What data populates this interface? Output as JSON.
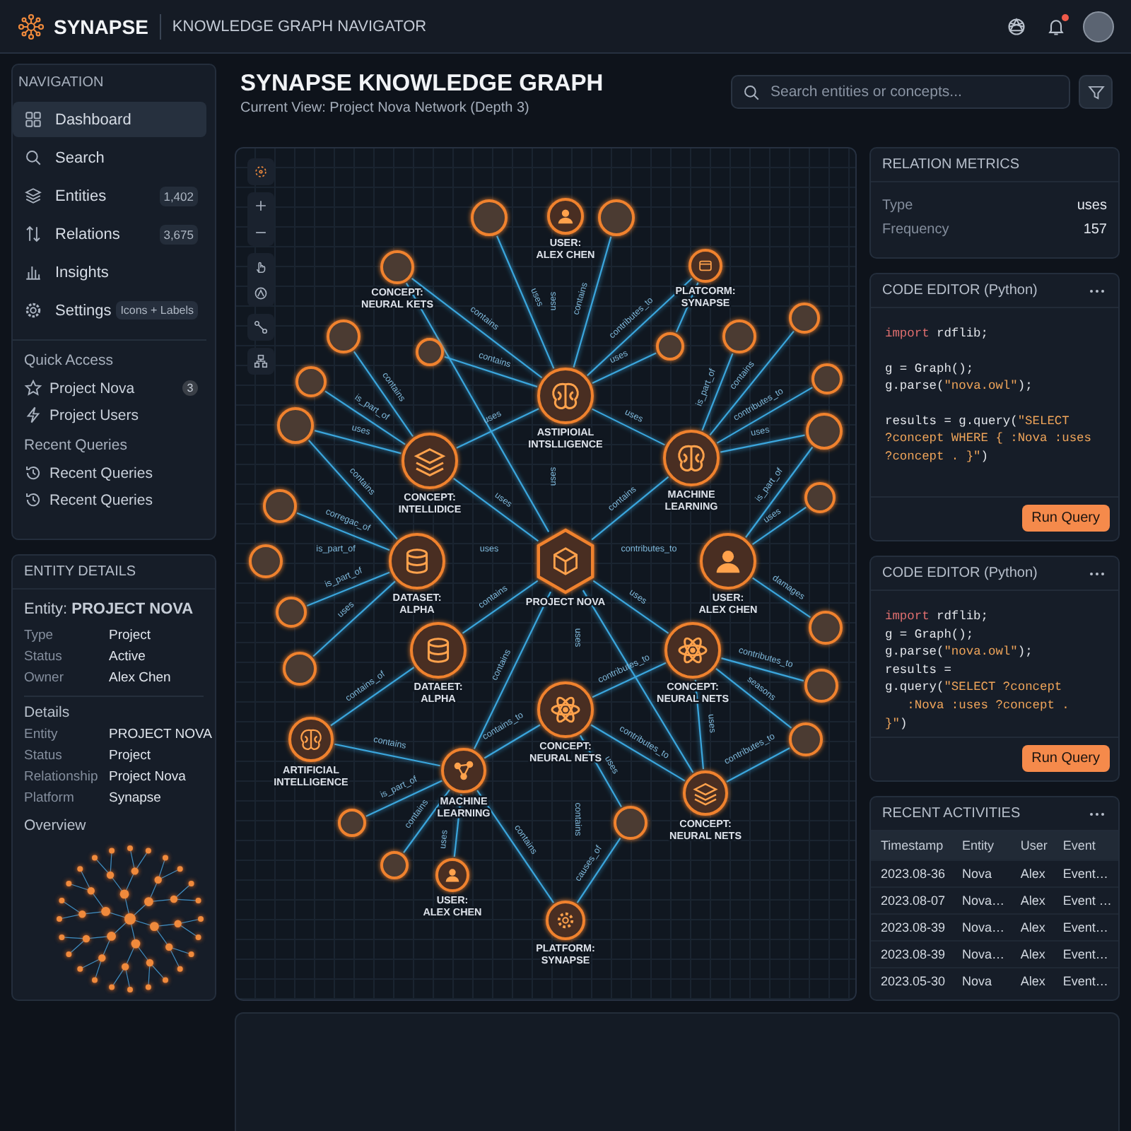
{
  "header": {
    "brand": "SYNAPSE",
    "subtitle": "KNOWLEDGE GRAPH NAVIGATOR",
    "unread_notifications": true
  },
  "sidebar": {
    "heading": "NAVIGATION",
    "items": [
      {
        "label": "Dashboard",
        "selected": true
      },
      {
        "label": "Search",
        "selected": false
      },
      {
        "label": "Entities",
        "count": "1,402",
        "selected": false
      },
      {
        "label": "Relations",
        "count": "3,675",
        "selected": false
      },
      {
        "label": "Insights",
        "selected": false
      },
      {
        "label": "Settings",
        "tag": "Icons + Labels",
        "selected": false
      }
    ],
    "quick_access": {
      "heading": "Quick Access",
      "items": [
        {
          "label": "Project Nova",
          "count": "3"
        },
        {
          "label": "Project Users"
        }
      ]
    },
    "recent_queries": {
      "heading": "Recent Queries",
      "items": [
        "Recent Queries",
        "Recent Queries"
      ]
    }
  },
  "entity_details": {
    "title": "ENTITY DETAILS",
    "entity": "Entity: **PROJECT NOVA**",
    "fields": [
      {
        "label": "Type",
        "value": "Project"
      },
      {
        "label": "Status",
        "value": "Active"
      },
      {
        "label": "Owner",
        "value": "Alex Chen"
      }
    ],
    "details_heading": "Details",
    "details": [
      {
        "label": "Entity",
        "value": "PROJECT NOVA"
      },
      {
        "label": "Status",
        "value": "Project"
      },
      {
        "label": "Relationship",
        "value": "Project Nova"
      },
      {
        "label": "Platform",
        "value": "Synapse"
      }
    ],
    "overview_heading": "Overview"
  },
  "main": {
    "title": "SYNAPSE KNOWLEDGE GRAPH",
    "current_view": "Current View: Project Nova Network (Depth 3)",
    "search": {
      "placeholder": "Search entities or concepts..."
    }
  },
  "graph": {
    "nodes": [
      {
        "kind": "entity",
        "label_lines": [
          "USER:",
          "ALEX CHEN"
        ]
      },
      {
        "kind": "leaf"
      },
      {
        "kind": "leaf"
      },
      {
        "kind": "leaf",
        "label_lines": [
          "CONCEPT:",
          "NEURAL KETS"
        ]
      },
      {
        "kind": "entity",
        "label_lines": [
          "PLATCORM:",
          "SYNAPSE"
        ]
      },
      {
        "kind": "leaf"
      },
      {
        "kind": "leaf"
      },
      {
        "kind": "leaf"
      },
      {
        "kind": "leaf"
      },
      {
        "kind": "leaf"
      },
      {
        "kind": "leaf"
      },
      {
        "kind": "leaf"
      },
      {
        "kind": "entity",
        "label_lines": [
          "ASTIPIOIAL",
          "INTSLLIGENCE"
        ]
      },
      {
        "kind": "leaf"
      },
      {
        "kind": "leaf"
      },
      {
        "kind": "entity",
        "label_lines": [
          "CONCEPT:",
          "INTELLIDICE"
        ]
      },
      {
        "kind": "entity",
        "label_lines": [
          "MACHINE",
          "LEARNING"
        ]
      },
      {
        "kind": "leaf"
      },
      {
        "kind": "leaf"
      },
      {
        "kind": "entity",
        "label_lines": [
          "DATASET:",
          "ALPHA"
        ]
      },
      {
        "kind": "hub",
        "label_lines": [
          "PROJECT NOVA"
        ]
      },
      {
        "kind": "entity",
        "label_lines": [
          "USER:",
          "ALEX CHEN"
        ]
      },
      {
        "kind": "leaf"
      },
      {
        "kind": "leaf"
      },
      {
        "kind": "leaf"
      },
      {
        "kind": "entity",
        "label_lines": [
          "DATAEET:",
          "ALPHA"
        ]
      },
      {
        "kind": "entity",
        "label_lines": [
          "CONCEPT:",
          "NEURAL NETS"
        ]
      },
      {
        "kind": "leaf"
      },
      {
        "kind": "leaf"
      },
      {
        "kind": "entity",
        "label_lines": [
          "CONCEPT:",
          "NEURAL NETS"
        ]
      },
      {
        "kind": "entity",
        "label_lines": [
          "ARTIFICIAL",
          "INTELLIGENCE"
        ]
      },
      {
        "kind": "leaf"
      },
      {
        "kind": "entity",
        "label_lines": [
          "MACHINE",
          "LEARNING"
        ]
      },
      {
        "kind": "entity",
        "label_lines": [
          "CONCEPT:",
          "NEURAL NETS"
        ]
      },
      {
        "kind": "leaf"
      },
      {
        "kind": "leaf"
      },
      {
        "kind": "leaf"
      },
      {
        "kind": "entity",
        "label_lines": [
          "USER:",
          "ALEX CHEN"
        ]
      },
      {
        "kind": "entity",
        "label_lines": [
          "PLATFORM:",
          "SYNAPSE"
        ]
      }
    ],
    "edges": [
      {
        "label": "uses"
      },
      {
        "label": "uses"
      },
      {
        "label": "contains"
      },
      {
        "label": "contains"
      },
      {
        "label": "contributes_to"
      },
      {
        "label": "contains"
      },
      {
        "label": "uses"
      },
      {
        "label": "contains"
      },
      {
        "label": "is_part_of"
      },
      {
        "label": "contains"
      },
      {
        "label": "is_part_of"
      },
      {
        "label": "contributes_to"
      },
      {
        "label": "uses"
      },
      {
        "label": "uses"
      },
      {
        "label": "uses"
      },
      {
        "label": "uses"
      },
      {
        "label": "uses"
      },
      {
        "label": "contains"
      },
      {
        "label": "is_part_of"
      },
      {
        "label": "uses"
      },
      {
        "label": "contains"
      },
      {
        "label": "uses"
      },
      {
        "label": "corregac_of"
      },
      {
        "label": "is_part_of"
      },
      {
        "label": "uses"
      },
      {
        "label": "contributes_to"
      },
      {
        "label": "is_part_of"
      },
      {
        "label": "damages"
      },
      {
        "label": "contains"
      },
      {
        "label": "uses"
      },
      {
        "label": "uses"
      },
      {
        "label": "uses"
      },
      {
        "label": "contains"
      },
      {
        "label": "contributes_to"
      },
      {
        "label": "contributes_to"
      },
      {
        "label": "contains_of"
      },
      {
        "label": "seasons"
      },
      {
        "label": "uses"
      },
      {
        "label": "contains_to"
      },
      {
        "label": "contributes_to"
      },
      {
        "label": "contains"
      },
      {
        "label": "uses"
      },
      {
        "label": "contributes_to"
      },
      {
        "label": "is_part_of"
      },
      {
        "label": "contains"
      },
      {
        "label": "contains"
      },
      {
        "label": "uses"
      },
      {
        "label": "contains"
      },
      {
        "label": "causes_of"
      }
    ]
  },
  "relation_metrics": {
    "title": "RELATION METRICS",
    "rows": [
      {
        "label": "Type",
        "value": "uses"
      },
      {
        "label": "Frequency",
        "value": "157"
      }
    ]
  },
  "code_editors": [
    {
      "title": "CODE EDITOR (Python)",
      "button": "Run Query",
      "blocks": [
        [
          {
            "tokens": [
              {
                "kind": "keyword",
                "text": "import"
              },
              {
                "kind": "plain",
                "text": " rdflib;"
              }
            ]
          }
        ],
        [
          {
            "tokens": [
              {
                "kind": "plain",
                "text": "g = Graph();"
              }
            ]
          },
          {
            "tokens": [
              {
                "kind": "plain",
                "text": "g.parse("
              },
              {
                "kind": "string",
                "text": "\"nova.owl\""
              },
              {
                "kind": "plain",
                "text": ");"
              }
            ]
          }
        ],
        [
          {
            "tokens": [
              {
                "kind": "plain",
                "text": "results = g.query("
              },
              {
                "kind": "string",
                "text": "\"SELECT"
              }
            ]
          },
          {
            "tokens": [
              {
                "kind": "string",
                "text": "?concept WHERE { :Nova :uses"
              }
            ]
          },
          {
            "tokens": [
              {
                "kind": "string",
                "text": "?concept . }\""
              },
              {
                "kind": "plain",
                "text": ")"
              }
            ]
          }
        ]
      ]
    },
    {
      "title": "CODE EDITOR (Python)",
      "button": "Run Query",
      "blocks": [
        [
          {
            "tokens": [
              {
                "kind": "keyword",
                "text": "import"
              },
              {
                "kind": "plain",
                "text": " rdflib;"
              }
            ]
          },
          {
            "tokens": [
              {
                "kind": "plain",
                "text": "g = Graph();"
              }
            ]
          },
          {
            "tokens": [
              {
                "kind": "plain",
                "text": "g.parse("
              },
              {
                "kind": "string",
                "text": "\"nova.owl\""
              },
              {
                "kind": "plain",
                "text": ");"
              }
            ]
          },
          {
            "tokens": [
              {
                "kind": "plain",
                "text": "results ="
              }
            ]
          },
          {
            "tokens": [
              {
                "kind": "plain",
                "text": "g.query("
              },
              {
                "kind": "string",
                "text": "\"SELECT ?concept"
              }
            ]
          },
          {
            "tokens": [
              {
                "kind": "string",
                "text": "   :Nova :uses ?concept ."
              }
            ]
          },
          {
            "tokens": [
              {
                "kind": "string",
                "text": "}\""
              },
              {
                "kind": "plain",
                "text": ")"
              }
            ]
          }
        ]
      ]
    }
  ],
  "recent_activities": {
    "title": "RECENT ACTIVITIES",
    "columns": [
      "Timestamp",
      "Entity",
      "User",
      "Event"
    ],
    "rows": [
      [
        "2023.08-36",
        "Nova",
        "Alex",
        "Event…"
      ],
      [
        "2023.08-07",
        "Nova…",
        "Alex",
        "Event …"
      ],
      [
        "2023.08-39",
        "Nova…",
        "Alex",
        "Event…"
      ],
      [
        "2023.08-39",
        "Nova…",
        "Alex",
        "Event…"
      ],
      [
        "2023.05-30",
        "Nova",
        "Alex",
        "Event…"
      ]
    ]
  }
}
